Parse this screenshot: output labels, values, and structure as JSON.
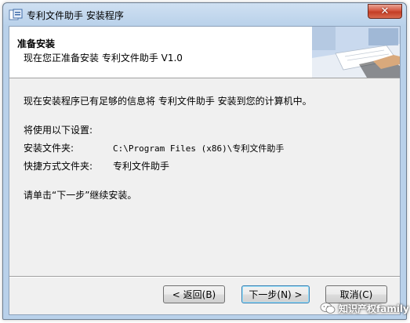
{
  "window": {
    "title": "专利文件助手 安装程序",
    "close_label": "✕"
  },
  "header": {
    "title": "准备安装",
    "subtitle": "现在您正准备安装 专利文件助手 V1.0"
  },
  "body": {
    "ready_message": "现在安装程序已有足够的信息将 专利文件助手 安装到您的计算机中。",
    "settings_heading": "将使用以下设置:",
    "install_folder_label": "安装文件夹:",
    "install_folder_value": "C:\\Program Files (x86)\\专利文件助手",
    "shortcut_folder_label": "快捷方式文件夹:",
    "shortcut_folder_value": "专利文件助手",
    "instruction": "请单击“下一步”继续安装。"
  },
  "buttons": {
    "back_label": "< 返回(B)",
    "next_label": "下一步(N) >",
    "cancel_label": "取消(C)"
  },
  "watermark": {
    "text": "知识产权family",
    "icon": "wechat-icon"
  }
}
